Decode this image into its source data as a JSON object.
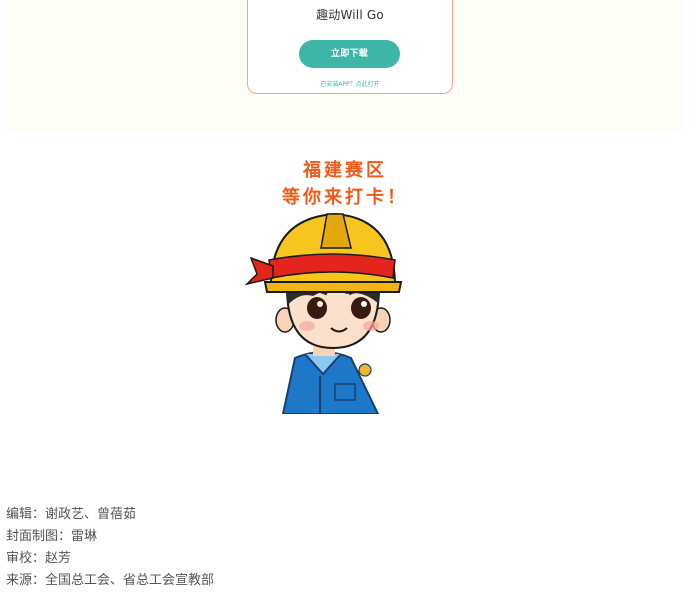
{
  "promo": {
    "app_name": "趣动Will Go",
    "download_label": "立即下载",
    "open_link": "已安装APP？点此打开"
  },
  "headline": {
    "line1": "福建赛区",
    "line2": "等你来打卡！"
  },
  "mascot": {
    "description_icon": "worker-mascot"
  },
  "credits": [
    "编辑：谢政艺、曾蓓茹",
    "封面制图：雷琳",
    "审校：赵芳",
    "来源：全国总工会、省总工会宣教部"
  ],
  "colors": {
    "accent_teal": "#3eb6a7",
    "headline_orange": "#f05a1a",
    "card_border": "#f2a58a",
    "banner_bg": "#fffdf6"
  }
}
